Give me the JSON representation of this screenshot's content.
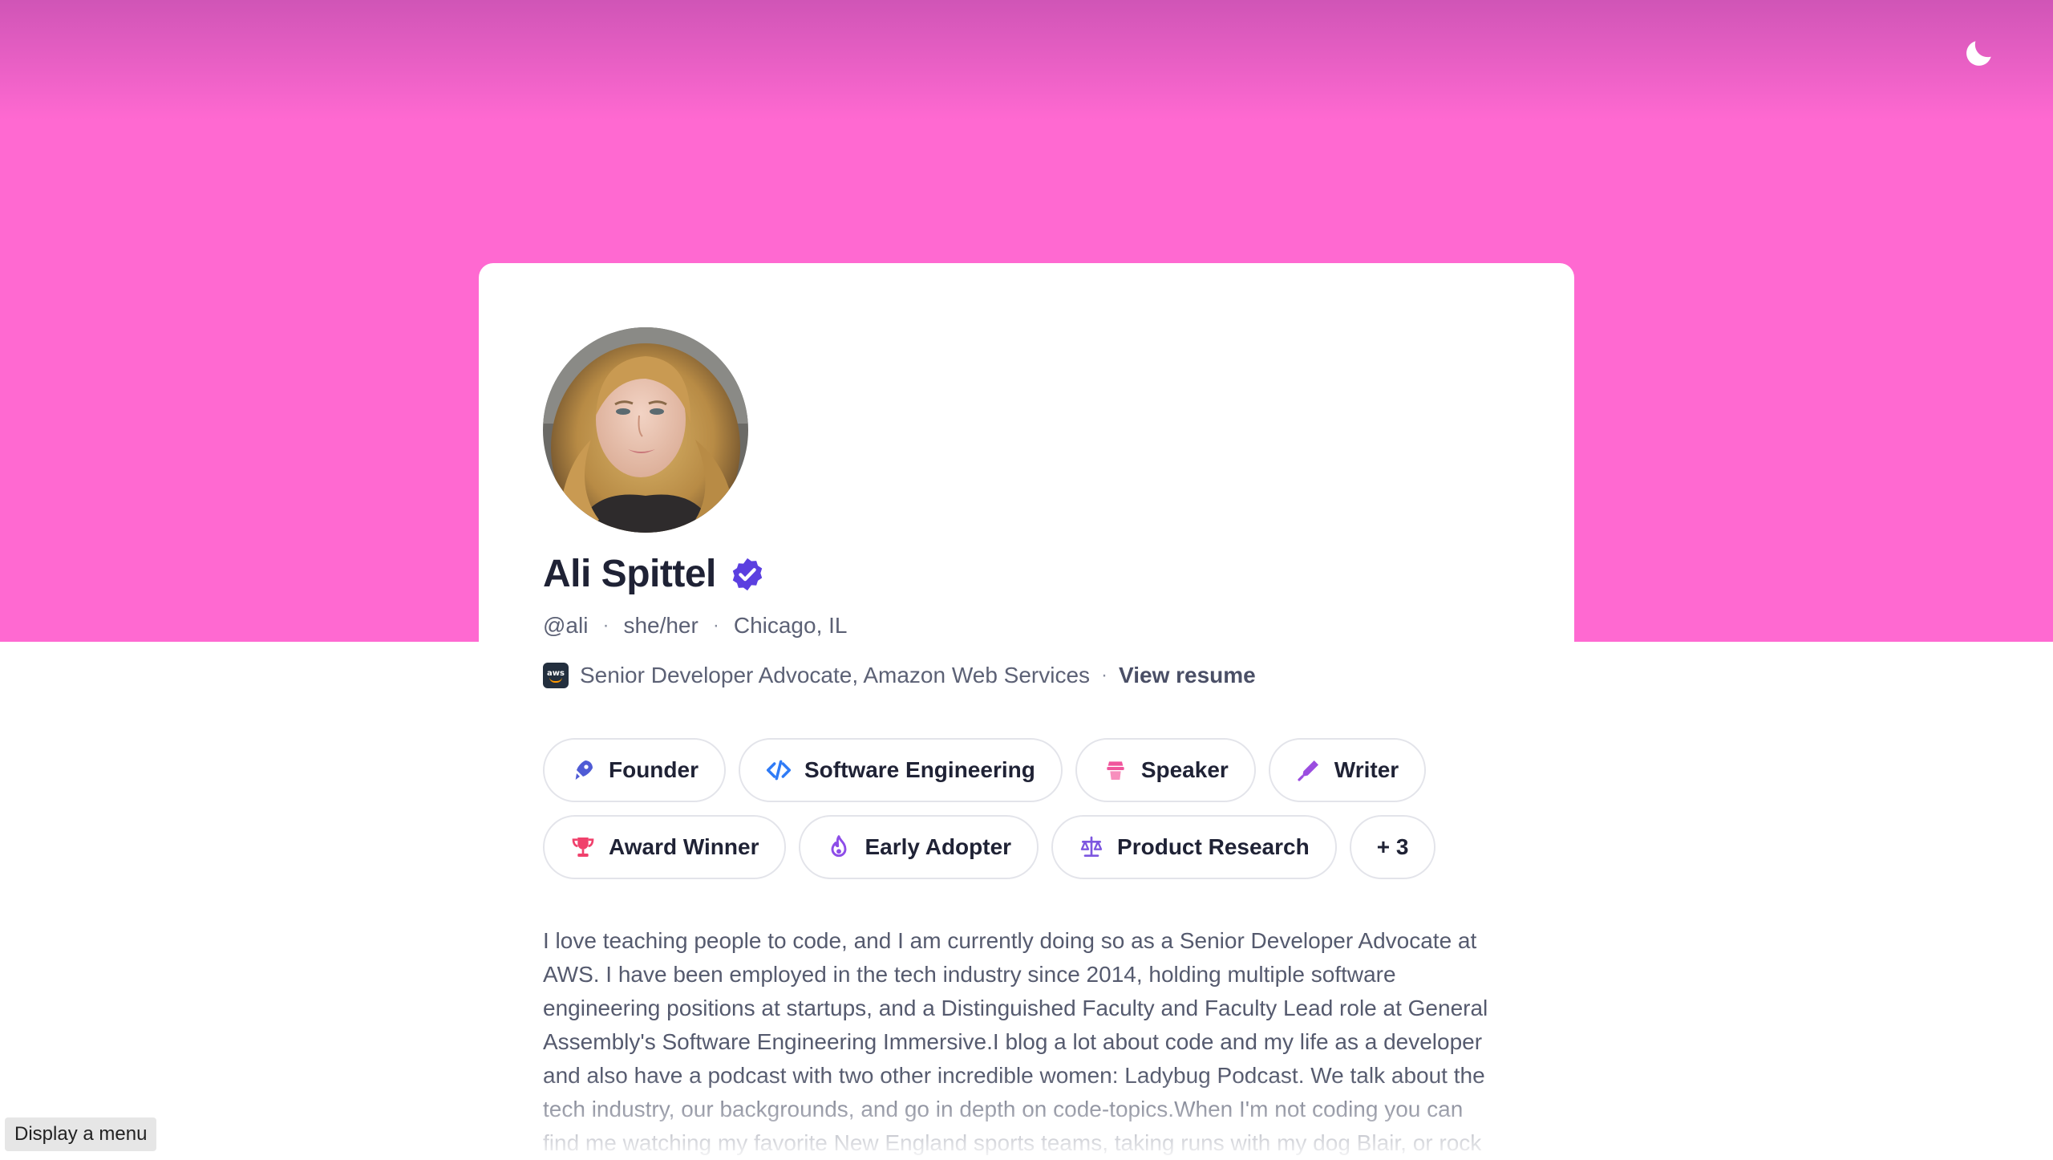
{
  "profile": {
    "name": "Ali Spittel",
    "handle": "@ali",
    "pronouns": "she/her",
    "location": "Chicago, IL",
    "separator": "·",
    "job_title": "Senior Developer Advocate, Amazon Web Services",
    "company_logo_text": "aws",
    "view_resume": "View resume",
    "verified_icon": "verified-badge-icon"
  },
  "tags": [
    {
      "label": "Founder",
      "icon": "rocket-icon",
      "color": "#4f5bd5"
    },
    {
      "label": "Software Engineering",
      "icon": "code-icon",
      "color": "#2f7bf6"
    },
    {
      "label": "Speaker",
      "icon": "podium-icon",
      "color": "#f0559c"
    },
    {
      "label": "Writer",
      "icon": "pen-icon",
      "color": "#9b4de0"
    },
    {
      "label": "Award Winner",
      "icon": "trophy-icon",
      "color": "#f0416c"
    },
    {
      "label": "Early Adopter",
      "icon": "flame-icon",
      "color": "#8d4de8"
    },
    {
      "label": "Product Research",
      "icon": "scales-icon",
      "color": "#7d56e0"
    },
    {
      "label": "+ 3",
      "icon": "",
      "color": ""
    }
  ],
  "bio": "I love teaching people to code, and I am currently doing so as a Senior Developer Advocate at AWS. I have been employed in the tech industry since 2014, holding multiple software engineering positions at startups, and a Distinguished Faculty and Faculty Lead role at General Assembly's Software Engineering Immersive.I blog a lot about code and my life as a developer and also have a podcast with two other incredible women: Ladybug Podcast. We talk about the tech industry, our backgrounds, and go in depth on code-topics.When I'm not coding you can find me watching my favorite New England sports teams, taking runs with my dog Blair, or rock",
  "menu_button": "Display a menu",
  "colors": {
    "banner": "#ff69d1",
    "verified": "#5b3fe0",
    "text_dark": "#1f2235"
  }
}
